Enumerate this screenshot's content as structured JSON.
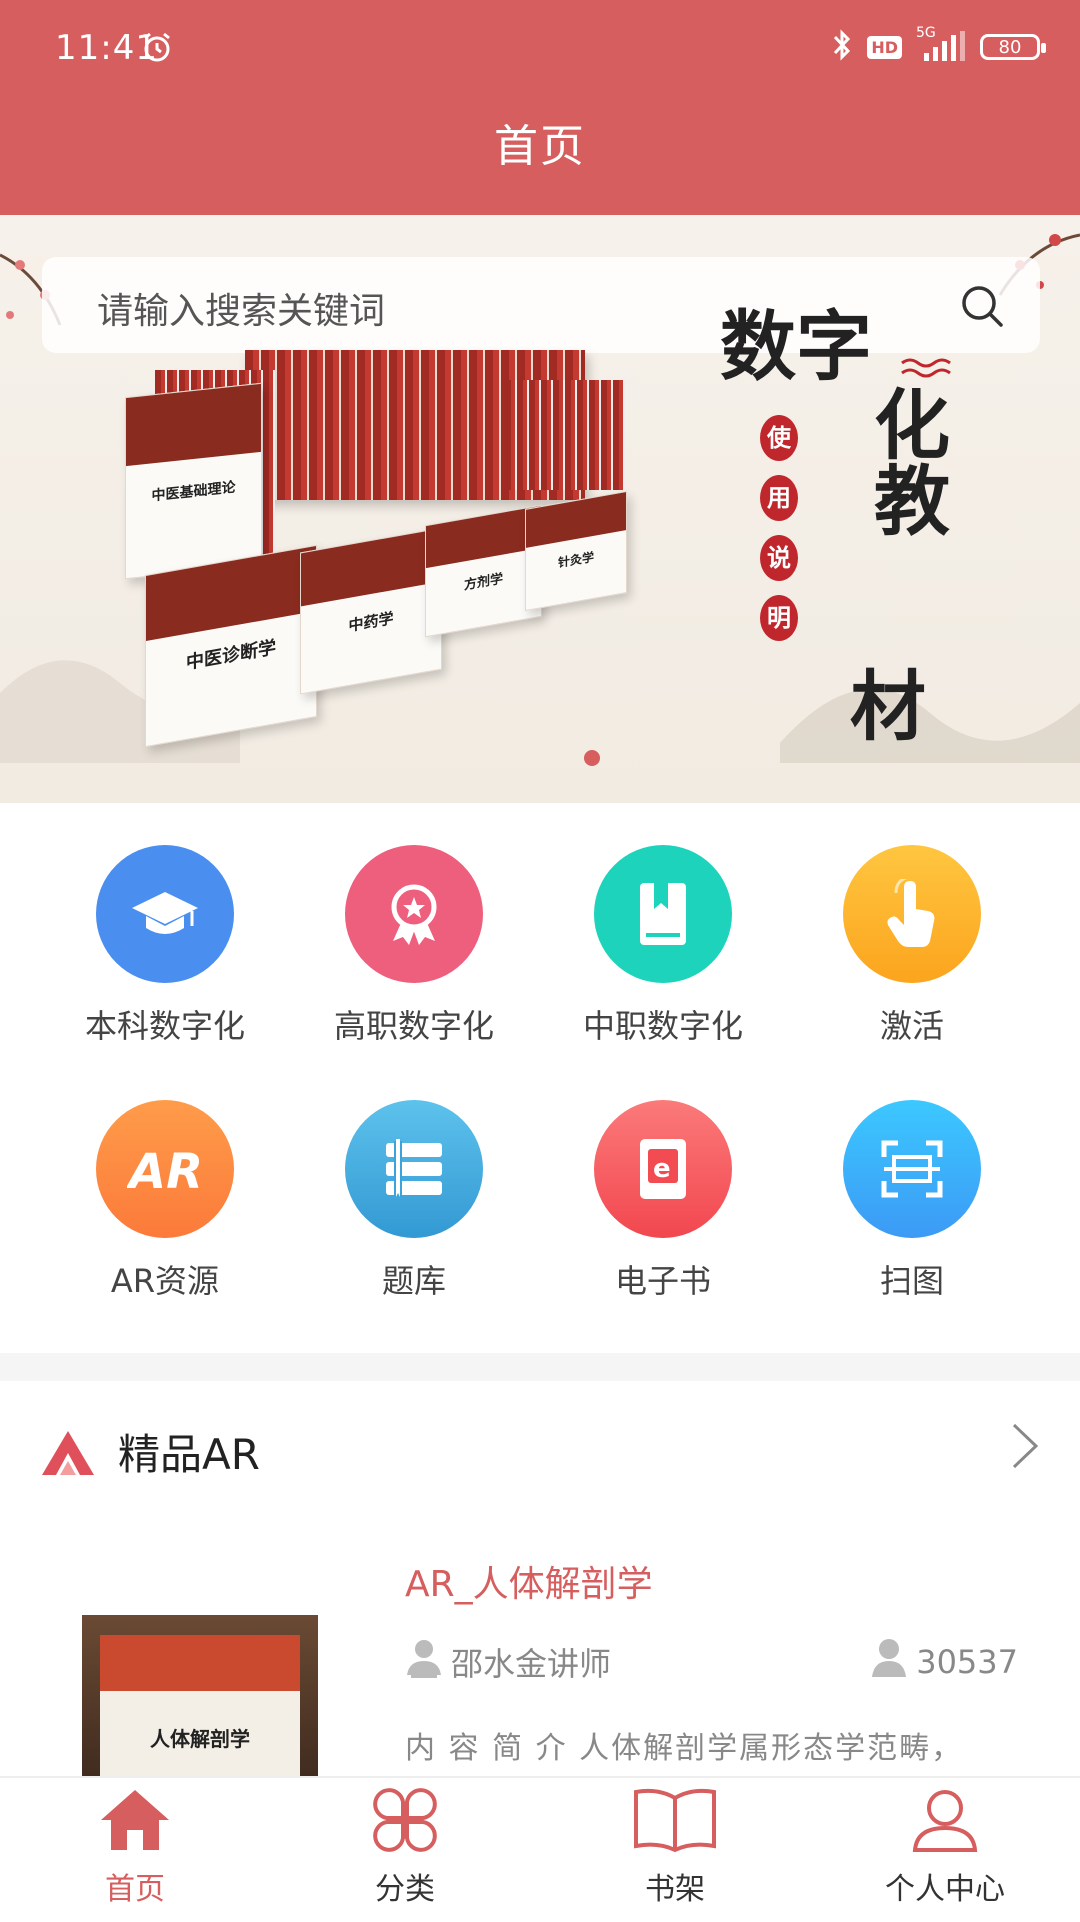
{
  "status_bar": {
    "time": "11:41",
    "network": "5G",
    "hd": "HD",
    "battery": "80"
  },
  "header": {
    "title": "首页"
  },
  "banner": {
    "search_placeholder": "请输入搜索关键词",
    "book_titles": [
      "中医基础理论",
      "中医诊断学",
      "中药学",
      "方剂学",
      "针灸学"
    ],
    "calligraphy": {
      "line1": "数字",
      "line2": "化教",
      "line3": "材",
      "seal": [
        "使",
        "用",
        "说",
        "明"
      ]
    }
  },
  "grid": {
    "items": [
      {
        "label": "本科数字化",
        "icon": "graduation-cap-icon",
        "color": "#4a8ff0"
      },
      {
        "label": "高职数字化",
        "icon": "award-badge-icon",
        "color": "#ee5f7e"
      },
      {
        "label": "中职数字化",
        "icon": "bookmark-book-icon",
        "color": "#1dd3bc"
      },
      {
        "label": "激活",
        "icon": "hand-tap-icon",
        "color": "#fdb331"
      },
      {
        "label": "AR资源",
        "icon": "ar-icon",
        "color": "#fd8a40"
      },
      {
        "label": "题库",
        "icon": "question-bank-icon",
        "color": "#40a9dc"
      },
      {
        "label": "电子书",
        "icon": "ebook-icon",
        "color": "#f55b63"
      },
      {
        "label": "扫图",
        "icon": "scan-icon",
        "color": "#2fb7f7"
      }
    ]
  },
  "section": {
    "title": "精品AR"
  },
  "card": {
    "title": "AR_人体解剖学",
    "author": "邵水金讲师",
    "views": "30537",
    "description": "内 容 简 介 人体解剖学属形态学范畴，",
    "thumb_title": "人体解剖学"
  },
  "bottom_nav": {
    "items": [
      {
        "label": "首页",
        "icon": "home-icon",
        "active": true
      },
      {
        "label": "分类",
        "icon": "category-icon",
        "active": false
      },
      {
        "label": "书架",
        "icon": "bookshelf-icon",
        "active": false
      },
      {
        "label": "个人中心",
        "icon": "user-icon",
        "active": false
      }
    ]
  },
  "colors": {
    "primary": "#d65e5e",
    "banner_bg": "#f6f1ea"
  }
}
